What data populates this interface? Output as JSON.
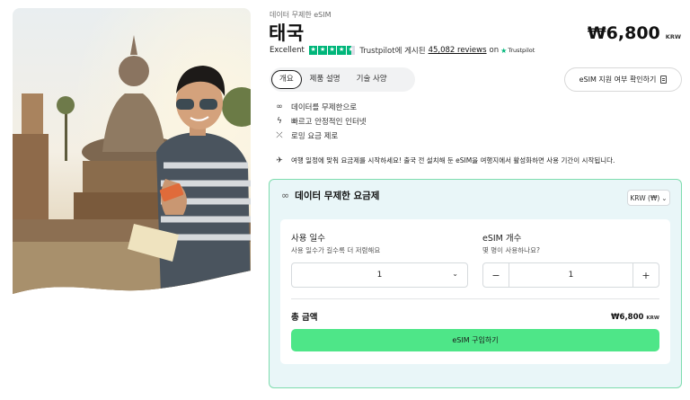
{
  "hero": {
    "image_alt": ""
  },
  "product": {
    "eyebrow": "데이터 무제한 eSIM",
    "title": "태국",
    "price": "₩6,800",
    "price_currency": "KRW"
  },
  "rating": {
    "label": "Excellent",
    "stars": 4.5,
    "provider_text": "Trustpilot에 게시된",
    "reviews": "45,082 reviews",
    "on": "on",
    "brand": "Trustpilot"
  },
  "tabs": [
    {
      "label": "개요",
      "active": true
    },
    {
      "label": "제품 설명",
      "active": false
    },
    {
      "label": "기술 사양",
      "active": false
    }
  ],
  "compat_button": {
    "label": "eSIM 지원 여부 확인하기",
    "icon": "document-icon"
  },
  "features": [
    {
      "icon": "infinity-icon",
      "glyph": "∞",
      "text": "데이터를 무제한으로"
    },
    {
      "icon": "bolt-icon",
      "glyph": "ϟ",
      "text": "빠르고 안정적인 인터넷"
    },
    {
      "icon": "no-roaming-icon",
      "glyph": "⤫",
      "text": "로밍 요금 제로"
    }
  ],
  "notice": {
    "icon": "plane-icon",
    "glyph": "✈",
    "text": "여행 일정에 맞춰 요금제를 시작하세요! 출국 전 설치해 둔 eSIM을 여행지에서 활성화하면 사용 기간이 시작됩니다."
  },
  "plan": {
    "heading": "데이터 무제한 요금제",
    "currency_select": "KRW (₩)",
    "days": {
      "title": "사용 일수",
      "subtitle": "사용 일수가 길수록 더 저렴해요",
      "value": "1"
    },
    "esims": {
      "title": "eSIM 개수",
      "subtitle": "몇 명이 사용하나요?",
      "value": "1",
      "minus": "−",
      "plus": "+"
    },
    "total_label": "총 금액",
    "total_amount": "₩6,800",
    "total_currency": "KRW",
    "buy_label": "eSIM 구입하기"
  },
  "colors": {
    "accent_green": "#4ee688",
    "trustpilot": "#00b67a",
    "plan_bg": "#e9f6f8"
  }
}
